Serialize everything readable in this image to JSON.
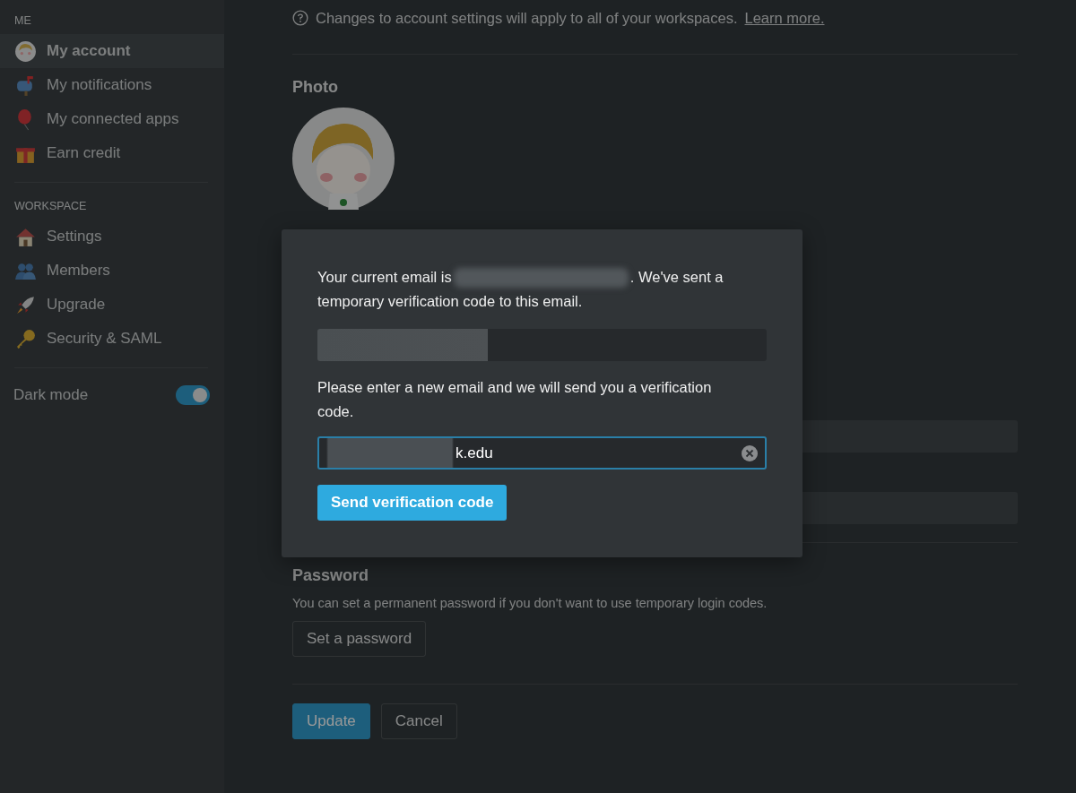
{
  "sidebar": {
    "sections": [
      {
        "heading": "ME",
        "items": [
          {
            "label": "My account",
            "selected": true
          },
          {
            "label": "My notifications",
            "selected": false
          },
          {
            "label": "My connected apps",
            "selected": false
          },
          {
            "label": "Earn credit",
            "selected": false
          }
        ]
      },
      {
        "heading": "WORKSPACE",
        "items": [
          {
            "label": "Settings",
            "selected": false
          },
          {
            "label": "Members",
            "selected": false
          },
          {
            "label": "Upgrade",
            "selected": false
          },
          {
            "label": "Security & SAML",
            "selected": false
          }
        ]
      }
    ],
    "dark_mode": {
      "label": "Dark mode",
      "on": true
    }
  },
  "notice": {
    "text": "Changes to account settings will apply to all of your workspaces.",
    "link": "Learn more."
  },
  "photo": {
    "heading": "Photo"
  },
  "password": {
    "heading": "Password",
    "description": "You can set a permanent password if you don't want to use temporary login codes.",
    "button": "Set a password"
  },
  "footer": {
    "buttons": [
      {
        "label": "Update",
        "kind": "primary"
      },
      {
        "label": "Cancel",
        "kind": "secondary"
      }
    ]
  },
  "dialog": {
    "intro": "Your current email is",
    "intro_after": ". We've sent a",
    "intro_line2": "temporary verification code to this email.",
    "prompt": "Please enter a new email and we will send you a verification code.",
    "new_email": {
      "value": "k.edu"
    },
    "button": "Send verification code"
  }
}
